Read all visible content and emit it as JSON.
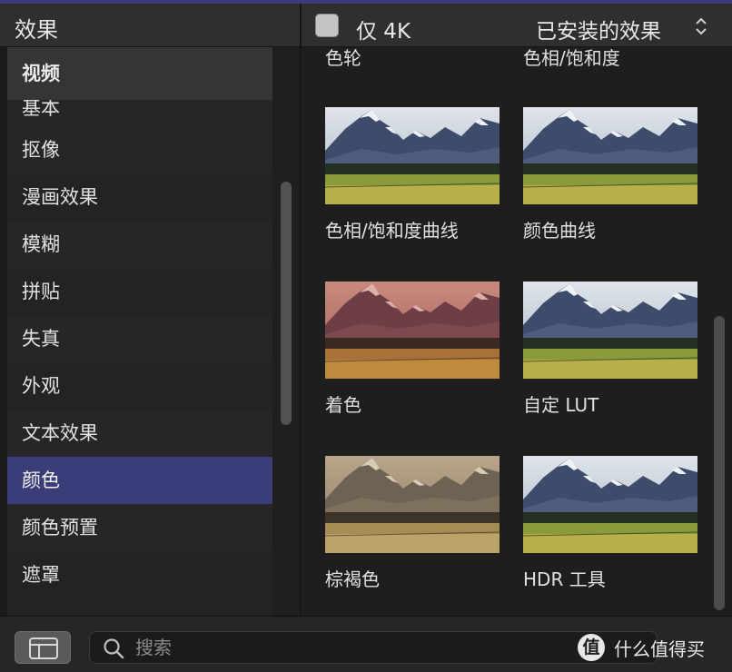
{
  "sidebar": {
    "title": "效果",
    "categories": [
      {
        "label": "视频",
        "kind": "section"
      },
      {
        "label": "基本",
        "kind": "partial"
      },
      {
        "label": "抠像"
      },
      {
        "label": "漫画效果"
      },
      {
        "label": "模糊"
      },
      {
        "label": "拼贴"
      },
      {
        "label": "失真"
      },
      {
        "label": "外观"
      },
      {
        "label": "文本效果"
      },
      {
        "label": "颜色",
        "selected": true
      },
      {
        "label": "颜色预置"
      },
      {
        "label": "遮罩"
      }
    ]
  },
  "browser": {
    "only_4k_label": "仅 4K",
    "only_4k_checked": false,
    "installed_filter": "已安装的效果",
    "effects": [
      {
        "label": "色轮",
        "tint": "none"
      },
      {
        "label": "色相/饱和度",
        "tint": "none"
      },
      {
        "label": "色相/饱和度曲线",
        "tint": "none"
      },
      {
        "label": "颜色曲线",
        "tint": "none"
      },
      {
        "label": "着色",
        "tint": "red"
      },
      {
        "label": "自定 LUT",
        "tint": "none"
      },
      {
        "label": "棕褐色",
        "tint": "sepia"
      },
      {
        "label": "HDR 工具",
        "tint": "none"
      }
    ]
  },
  "bottombar": {
    "search_placeholder": "搜索",
    "search_value": ""
  },
  "watermark": {
    "logo_char": "值",
    "text": "什么值得买"
  },
  "colors": {
    "accent_selected": "#3b3d78",
    "panel": "#262626",
    "header": "#2f2f2f"
  }
}
